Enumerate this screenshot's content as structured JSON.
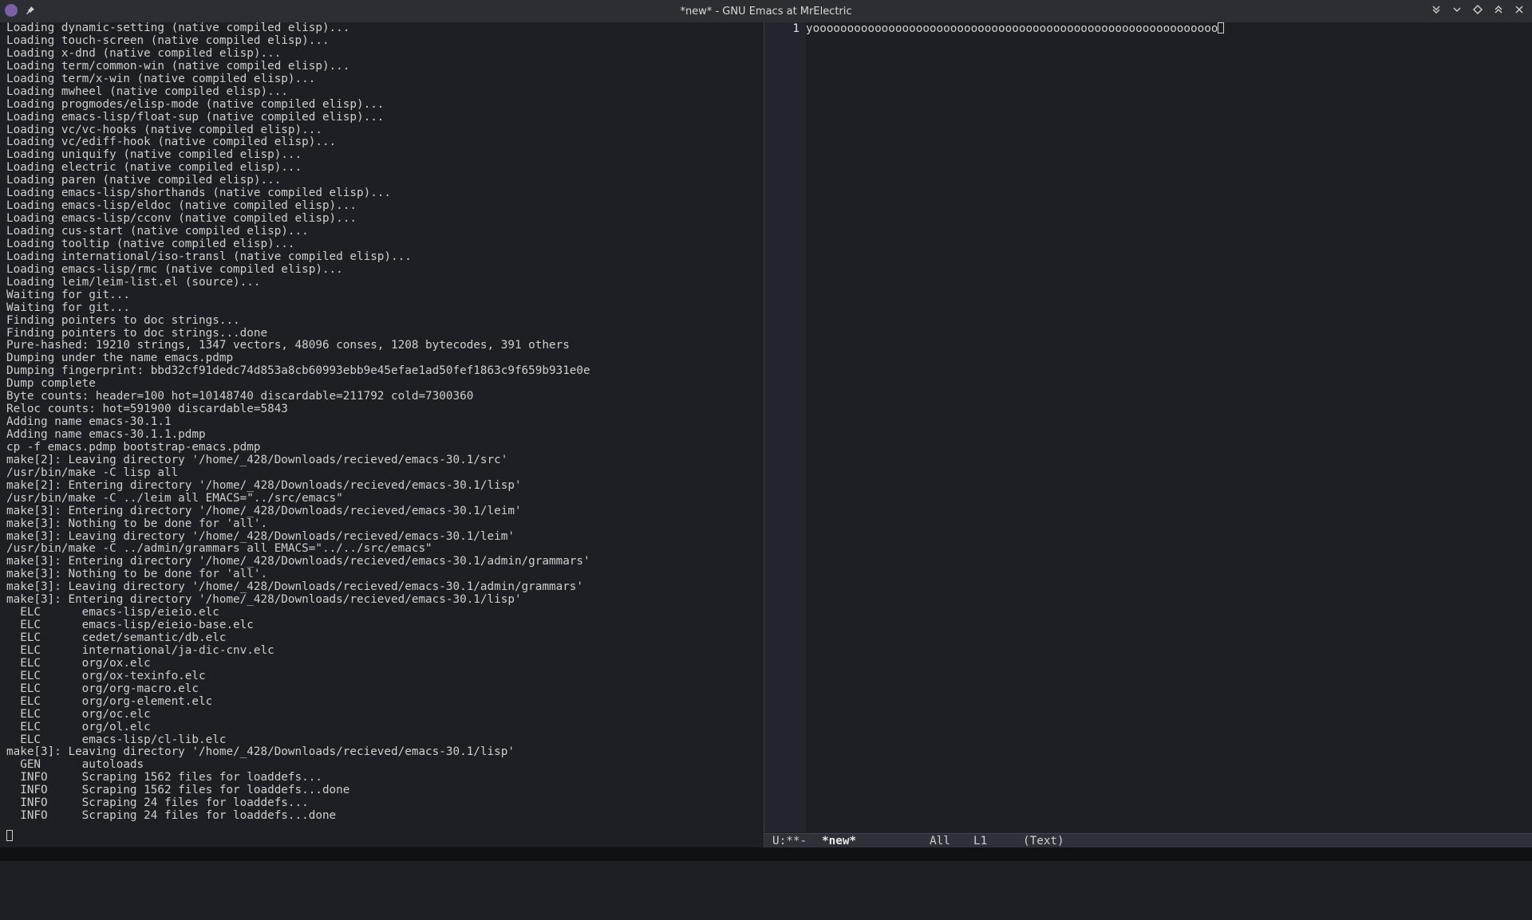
{
  "window": {
    "title": "*new* - GNU Emacs at MrElectric"
  },
  "icons": {
    "app": "emacs-icon",
    "pin": "pin-icon",
    "right": [
      "minimize-down-icon",
      "chevron-down-icon",
      "diamond-icon",
      "maximize-up-icon",
      "close-icon"
    ]
  },
  "terminal": {
    "lines": [
      "Loading dynamic-setting (native compiled elisp)...",
      "Loading touch-screen (native compiled elisp)...",
      "Loading x-dnd (native compiled elisp)...",
      "Loading term/common-win (native compiled elisp)...",
      "Loading term/x-win (native compiled elisp)...",
      "Loading mwheel (native compiled elisp)...",
      "Loading progmodes/elisp-mode (native compiled elisp)...",
      "Loading emacs-lisp/float-sup (native compiled elisp)...",
      "Loading vc/vc-hooks (native compiled elisp)...",
      "Loading vc/ediff-hook (native compiled elisp)...",
      "Loading uniquify (native compiled elisp)...",
      "Loading electric (native compiled elisp)...",
      "Loading paren (native compiled elisp)...",
      "Loading emacs-lisp/shorthands (native compiled elisp)...",
      "Loading emacs-lisp/eldoc (native compiled elisp)...",
      "Loading emacs-lisp/cconv (native compiled elisp)...",
      "Loading cus-start (native compiled elisp)...",
      "Loading tooltip (native compiled elisp)...",
      "Loading international/iso-transl (native compiled elisp)...",
      "Loading emacs-lisp/rmc (native compiled elisp)...",
      "Loading leim/leim-list.el (source)...",
      "Waiting for git...",
      "Waiting for git...",
      "Finding pointers to doc strings...",
      "Finding pointers to doc strings...done",
      "Pure-hashed: 19210 strings, 1347 vectors, 48096 conses, 1208 bytecodes, 391 others",
      "Dumping under the name emacs.pdmp",
      "Dumping fingerprint: bbd32cf91dedc74d853a8cb60993ebb9e45efae1ad50fef1863c9f659b931e0e",
      "Dump complete",
      "Byte counts: header=100 hot=10148740 discardable=211792 cold=7300360",
      "Reloc counts: hot=591900 discardable=5843",
      "Adding name emacs-30.1.1",
      "Adding name emacs-30.1.1.pdmp",
      "cp -f emacs.pdmp bootstrap-emacs.pdmp",
      "make[2]: Leaving directory '/home/_428/Downloads/recieved/emacs-30.1/src'",
      "/usr/bin/make -C lisp all",
      "make[2]: Entering directory '/home/_428/Downloads/recieved/emacs-30.1/lisp'",
      "/usr/bin/make -C ../leim all EMACS=\"../src/emacs\"",
      "make[3]: Entering directory '/home/_428/Downloads/recieved/emacs-30.1/leim'",
      "make[3]: Nothing to be done for 'all'.",
      "make[3]: Leaving directory '/home/_428/Downloads/recieved/emacs-30.1/leim'",
      "/usr/bin/make -C ../admin/grammars all EMACS=\"../../src/emacs\"",
      "make[3]: Entering directory '/home/_428/Downloads/recieved/emacs-30.1/admin/grammars'",
      "make[3]: Nothing to be done for 'all'.",
      "make[3]: Leaving directory '/home/_428/Downloads/recieved/emacs-30.1/admin/grammars'",
      "make[3]: Entering directory '/home/_428/Downloads/recieved/emacs-30.1/lisp'",
      "  ELC      emacs-lisp/eieio.elc",
      "  ELC      emacs-lisp/eieio-base.elc",
      "  ELC      cedet/semantic/db.elc",
      "  ELC      international/ja-dic-cnv.elc",
      "  ELC      org/ox.elc",
      "  ELC      org/ox-texinfo.elc",
      "  ELC      org/org-macro.elc",
      "  ELC      org/org-element.elc",
      "  ELC      org/oc.elc",
      "  ELC      org/ol.elc",
      "  ELC      emacs-lisp/cl-lib.elc",
      "make[3]: Leaving directory '/home/_428/Downloads/recieved/emacs-30.1/lisp'",
      "  GEN      autoloads",
      "  INFO     Scraping 1562 files for loaddefs...",
      "  INFO     Scraping 1562 files for loaddefs...done",
      "  INFO     Scraping 24 files for loaddefs...",
      "  INFO     Scraping 24 files for loaddefs...done"
    ]
  },
  "editor": {
    "line_number": "1",
    "text": "yooooooooooooooooooooooooooooooooooooooooooooooooooooooooooo"
  },
  "modeline": {
    "status": "U:**-",
    "buffer": "*new*",
    "position": "All",
    "line": "L1",
    "mode": "(Text)"
  },
  "colors": {
    "background": "#1c1f24",
    "titlebar": "#2b2e33",
    "modeline": "#2e3238",
    "text": "#cfcfcf"
  }
}
